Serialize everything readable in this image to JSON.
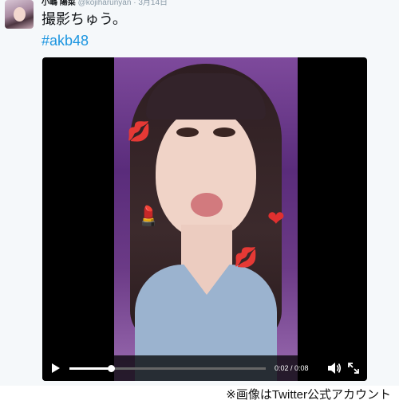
{
  "tweet": {
    "user": {
      "name": "小嶋 陽菜",
      "handle": "@kojiharunyan",
      "separator": "·",
      "date": "3月14日"
    },
    "text": "撮影ちゅう。",
    "hashtag": "#akb48"
  },
  "player": {
    "time": "0:02 / 0:08",
    "progress": 0.21,
    "stickers": {
      "kiss_1": "💋",
      "lipstick": "💄",
      "heart": "❤",
      "kiss_2": "💋"
    },
    "icons": {
      "play": "play-icon",
      "volume": "volume-icon",
      "fullscreen": "fullscreen-icon"
    }
  },
  "credit": "※画像はTwitter公式アカウント"
}
